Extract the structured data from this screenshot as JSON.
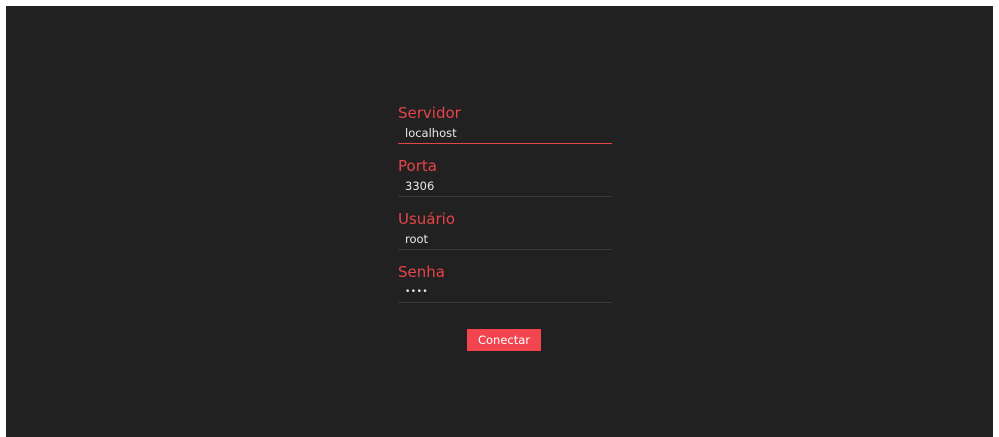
{
  "login_form": {
    "server": {
      "label": "Servidor",
      "value": "localhost"
    },
    "port": {
      "label": "Porta",
      "value": "3306"
    },
    "user": {
      "label": "Usuário",
      "value": "root"
    },
    "password": {
      "label": "Senha",
      "value": "••••"
    },
    "connect_label": "Conectar"
  },
  "colors": {
    "background": "#212121",
    "accent": "#e6434a",
    "button": "#f2454f",
    "text": "#e8e8e8"
  }
}
